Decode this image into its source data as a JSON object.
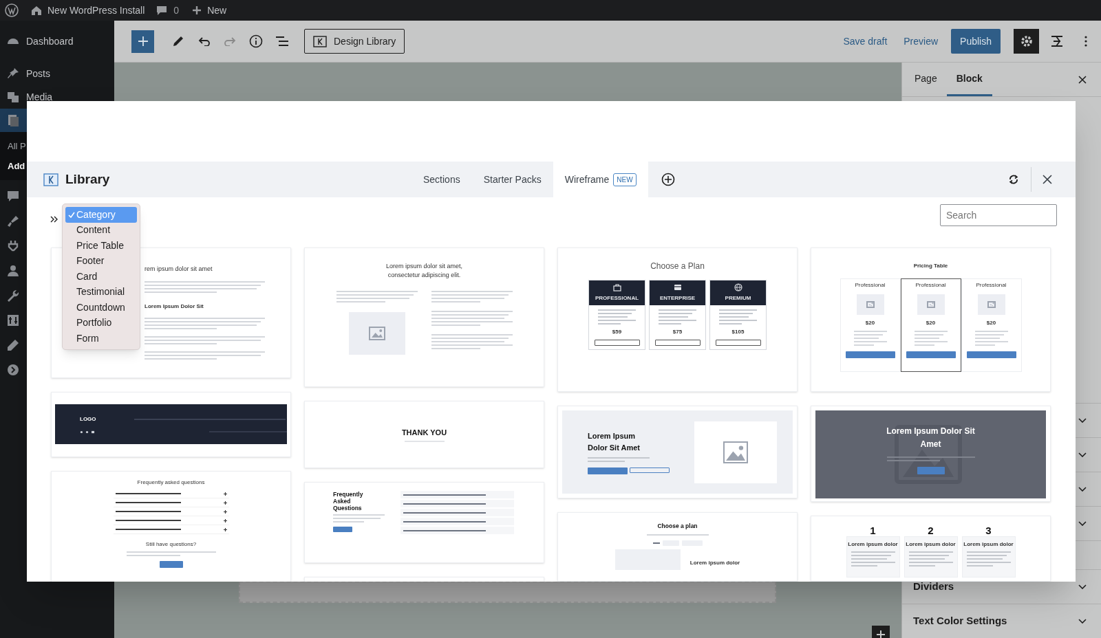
{
  "admin_bar": {
    "site_name": "New WordPress Install",
    "comments": "0",
    "new": "New"
  },
  "admin_menu": [
    {
      "label": "Dashboard",
      "selected": false
    },
    {
      "label": "Posts",
      "selected": false
    },
    {
      "label": "Media",
      "selected": false
    },
    {
      "selected": true,
      "submenu": [
        {
          "label": "All P",
          "selected": false
        },
        {
          "label": "Add",
          "selected": true
        }
      ]
    },
    {
      "selected": false
    },
    {
      "selected": false
    },
    {
      "selected": false
    },
    {
      "selected": false
    },
    {
      "selected": false
    },
    {
      "selected": false
    },
    {
      "selected": false
    },
    {
      "selected": false
    }
  ],
  "editor_toolbar": {
    "design_library": "Design Library",
    "save_draft": "Save draft",
    "preview": "Preview",
    "publish": "Publish"
  },
  "settings_panel": {
    "tabs": [
      {
        "label": "Page",
        "selected": false
      },
      {
        "label": "Block",
        "selected": true
      }
    ],
    "sections": [
      {
        "label": "Dividers"
      },
      {
        "label": "Text Color Settings"
      }
    ]
  },
  "modal": {
    "title": "Library",
    "tabs": [
      {
        "label": "Sections",
        "selected": false
      },
      {
        "label": "Starter Packs",
        "selected": false
      },
      {
        "label": "Wireframe",
        "badge": "NEW",
        "selected": true
      }
    ],
    "search": {
      "placeholder": "Search"
    },
    "category_menu": [
      {
        "label": "Category",
        "selected": true
      },
      {
        "label": "Content",
        "selected": false
      },
      {
        "label": "Price Table",
        "selected": false
      },
      {
        "label": "Footer",
        "selected": false
      },
      {
        "label": "Card",
        "selected": false
      },
      {
        "label": "Testimonial",
        "selected": false
      },
      {
        "label": "Countdown",
        "selected": false
      },
      {
        "label": "Portfolio",
        "selected": false
      },
      {
        "label": "Form",
        "selected": false
      }
    ],
    "columns": [
      [
        {
          "kind": "article",
          "heading": "rem ipsum dolor sit amet",
          "subheading": "Lorem Ipsum Dolor Sit"
        },
        {
          "kind": "footer",
          "logo": "LOGO"
        },
        {
          "kind": "faq_centered",
          "heading": "Frequently asked questions",
          "subheading": "Still have questions?"
        }
      ],
      [
        {
          "kind": "intro_two_col",
          "heading": "Lorem ipsum dolor sit amet, consectetur adipiscing elit."
        },
        {
          "kind": "thank_you",
          "heading": "THANK YOU"
        },
        {
          "kind": "faq_split",
          "heading": "Frequently Asked Questions"
        },
        {
          "kind": "blank"
        }
      ],
      [
        {
          "kind": "plans_dark",
          "heading": "Choose a Plan",
          "plans": [
            {
              "name": "PROFESSIONAL",
              "price": "$59"
            },
            {
              "name": "ENTERPRISE",
              "price": "$75"
            },
            {
              "name": "PREMIUM",
              "price": "$105"
            }
          ]
        },
        {
          "kind": "hero_light",
          "heading": "Lorem Ipsum Dolor Sit Amet"
        },
        {
          "kind": "choose_plan",
          "heading": "Choose a plan",
          "subheading": "Lorem ipsum dolor"
        }
      ],
      [
        {
          "kind": "pricing_table",
          "heading": "Pricing Table",
          "plans": [
            {
              "name": "Professional",
              "price": "$20",
              "selected": false
            },
            {
              "name": "Professional",
              "price": "$20",
              "selected": true
            },
            {
              "name": "Professional",
              "price": "$20",
              "selected": false
            }
          ]
        },
        {
          "kind": "hero_dark",
          "heading": "Lorem Ipsum Dolor Sit Amet"
        },
        {
          "kind": "steps",
          "steps": [
            {
              "number": "1",
              "title": "Lorem ipsum dolor"
            },
            {
              "number": "2",
              "title": "Lorem ipsum dolor"
            },
            {
              "number": "3",
              "title": "Lorem ipsum dolor"
            }
          ]
        }
      ]
    ]
  }
}
